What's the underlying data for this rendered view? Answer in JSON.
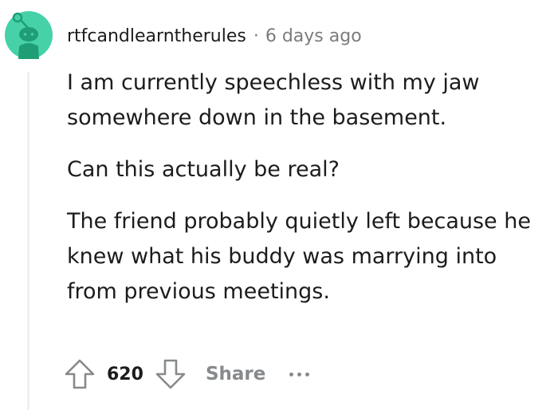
{
  "comment": {
    "author": "rtfcandlearntherules",
    "separator": "·",
    "timestamp": "6 days ago",
    "paragraphs": [
      "I am currently speechless with my jaw somewhere down in the basement.",
      "Can this actually be real?",
      "The friend probably quietly left because he knew what his buddy was marrying into from previous meetings."
    ]
  },
  "actions": {
    "score": "620",
    "share_label": "Share"
  },
  "icons": {
    "avatar": "snoo-avatar-icon",
    "upvote": "arrow-up-icon",
    "downvote": "arrow-down-icon",
    "more": "more-options-icon"
  },
  "colors": {
    "avatar_background": "#46d1a8",
    "avatar_figure": "#1f9e76",
    "text": "#1c1c1c",
    "meta": "#7c7c7c",
    "action_gray": "#878a8c",
    "thread_line": "#edeff1"
  }
}
